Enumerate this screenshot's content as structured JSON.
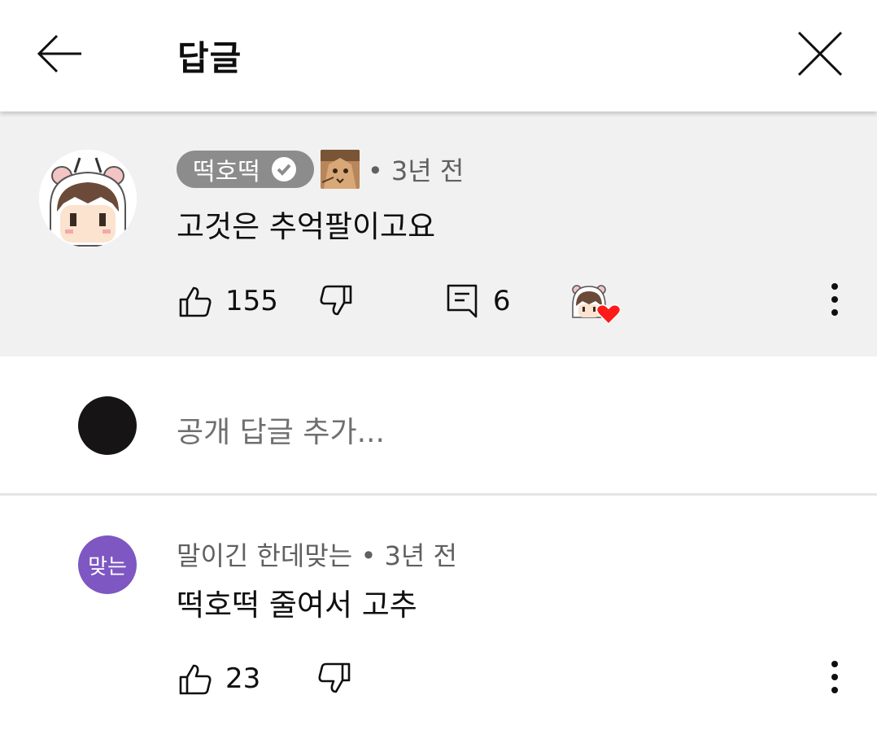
{
  "header": {
    "title": "답글"
  },
  "parent_comment": {
    "author": "떡호떡",
    "time": "• 3년 전",
    "text": "고것은 추억팔이고요",
    "likes": "155",
    "replies": "6"
  },
  "reply_input": {
    "placeholder": "공개 답글 추가..."
  },
  "replies": [
    {
      "author": "말이긴 한데맞는",
      "time": "• 3년 전",
      "avatar_text": "맞는",
      "avatar_color": "#7e57c2",
      "text": "떡호떡 줄여서 고추",
      "likes": "23"
    }
  ]
}
